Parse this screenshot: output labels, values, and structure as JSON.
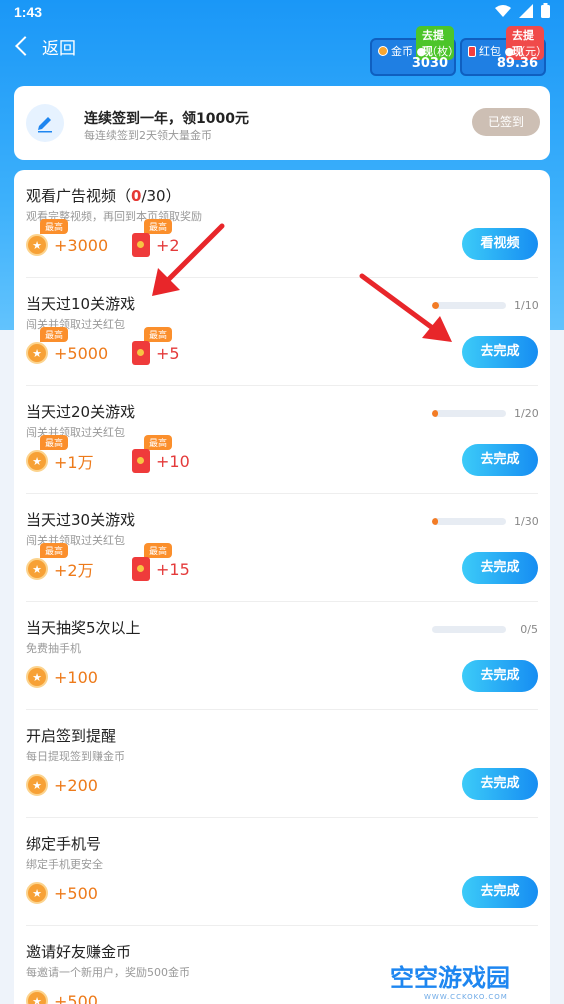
{
  "status_bar": {
    "time": "1:43"
  },
  "nav": {
    "back_label": "返回"
  },
  "wallet": {
    "coin": {
      "tag": "去提现",
      "label": "金币 ●（枚）",
      "value": "3030"
    },
    "red": {
      "tag": "去提现",
      "label": "红包 ●（元）",
      "value": "89.36"
    }
  },
  "signin": {
    "title": "连续签到一年，领1000元",
    "subtitle": "每连续签到2天领大量金币",
    "button": "已签到"
  },
  "max_tag": "最高",
  "tasks": [
    {
      "title_prefix": "观看广告视频（",
      "title_hl": "0",
      "title_suffix": "/30）",
      "subtitle": "观看完整视频，再回到本页领取奖励",
      "coin": "+3000",
      "red": "+2",
      "button": "看视频",
      "progress": null
    },
    {
      "title": "当天过10关游戏",
      "subtitle": "闯关并领取过关红包",
      "coin": "+5000",
      "red": "+5",
      "button": "去完成",
      "progress": {
        "text": "1/10",
        "fraction": 0.1
      }
    },
    {
      "title": "当天过20关游戏",
      "subtitle": "闯关并领取过关红包",
      "coin": "+1万",
      "red": "+10",
      "button": "去完成",
      "progress": {
        "text": "1/20",
        "fraction": 0.05
      }
    },
    {
      "title": "当天过30关游戏",
      "subtitle": "闯关并领取过关红包",
      "coin": "+2万",
      "red": "+15",
      "button": "去完成",
      "progress": {
        "text": "1/30",
        "fraction": 0.033
      }
    },
    {
      "title": "当天抽奖5次以上",
      "subtitle": "免费抽手机",
      "coin": "+100",
      "red": null,
      "button": "去完成",
      "progress": {
        "text": "0/5",
        "fraction": 0
      }
    },
    {
      "title": "开启签到提醒",
      "subtitle": "每日提现签到赚金币",
      "coin": "+200",
      "red": null,
      "button": "去完成",
      "progress": null
    },
    {
      "title": "绑定手机号",
      "subtitle": "绑定手机更安全",
      "coin": "+500",
      "red": null,
      "button": "去完成",
      "progress": null
    },
    {
      "title": "邀请好友赚金币",
      "subtitle": "每邀请一个新用户，奖励500金币",
      "coin": "+500",
      "red": null,
      "button": null,
      "progress": null
    }
  ],
  "watermark": {
    "text": "空空游戏园",
    "sub": "WWW.CCKOKO.COM"
  },
  "colors": {
    "accent": "#168df2",
    "orange": "#f37c25",
    "red": "#e53935"
  }
}
